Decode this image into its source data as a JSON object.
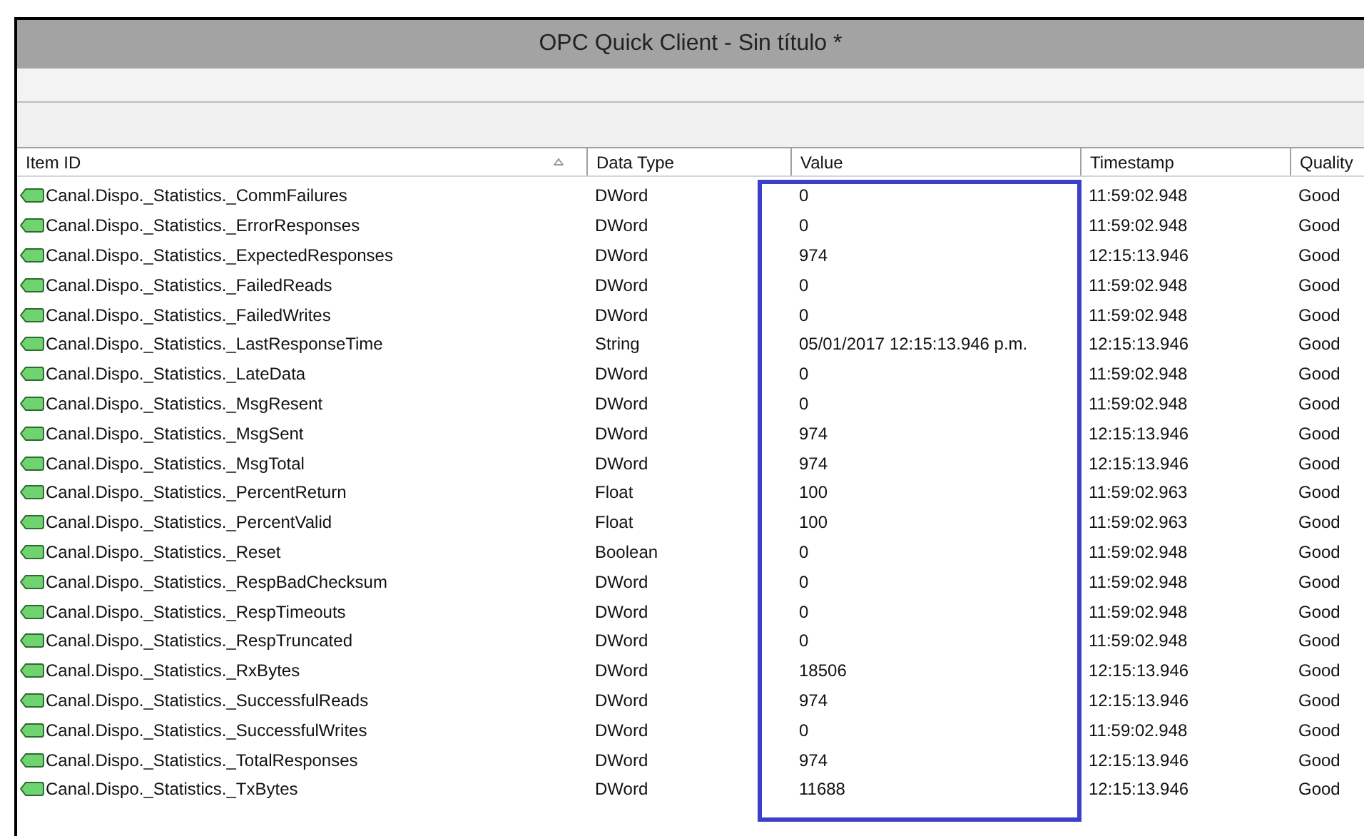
{
  "window": {
    "title": "OPC Quick Client - Sin título *"
  },
  "table": {
    "columns": [
      {
        "label": "Item ID",
        "sorted": true,
        "highlighted": false
      },
      {
        "label": "Data Type",
        "sorted": false,
        "highlighted": false
      },
      {
        "label": "Value",
        "sorted": false,
        "highlighted": true
      },
      {
        "label": "Timestamp",
        "sorted": false,
        "highlighted": false
      },
      {
        "label": "Quality",
        "sorted": false,
        "highlighted": false
      }
    ],
    "rows": [
      [
        "Canal.Dispo._Statistics._CommFailures",
        "DWord",
        "0",
        "11:59:02.948",
        "Good"
      ],
      [
        "Canal.Dispo._Statistics._ErrorResponses",
        "DWord",
        "0",
        "11:59:02.948",
        "Good"
      ],
      [
        "Canal.Dispo._Statistics._ExpectedResponses",
        "DWord",
        "974",
        "12:15:13.946",
        "Good"
      ],
      [
        "Canal.Dispo._Statistics._FailedReads",
        "DWord",
        "0",
        "11:59:02.948",
        "Good"
      ],
      [
        "Canal.Dispo._Statistics._FailedWrites",
        "DWord",
        "0",
        "11:59:02.948",
        "Good"
      ],
      [
        "Canal.Dispo._Statistics._LastResponseTime",
        "String",
        "05/01/2017 12:15:13.946 p.m.",
        "12:15:13.946",
        "Good"
      ],
      [
        "Canal.Dispo._Statistics._LateData",
        "DWord",
        "0",
        "11:59:02.948",
        "Good"
      ],
      [
        "Canal.Dispo._Statistics._MsgResent",
        "DWord",
        "0",
        "11:59:02.948",
        "Good"
      ],
      [
        "Canal.Dispo._Statistics._MsgSent",
        "DWord",
        "974",
        "12:15:13.946",
        "Good"
      ],
      [
        "Canal.Dispo._Statistics._MsgTotal",
        "DWord",
        "974",
        "12:15:13.946",
        "Good"
      ],
      [
        "Canal.Dispo._Statistics._PercentReturn",
        "Float",
        "100",
        "11:59:02.963",
        "Good"
      ],
      [
        "Canal.Dispo._Statistics._PercentValid",
        "Float",
        "100",
        "11:59:02.963",
        "Good"
      ],
      [
        "Canal.Dispo._Statistics._Reset",
        "Boolean",
        "0",
        "11:59:02.948",
        "Good"
      ],
      [
        "Canal.Dispo._Statistics._RespBadChecksum",
        "DWord",
        "0",
        "11:59:02.948",
        "Good"
      ],
      [
        "Canal.Dispo._Statistics._RespTimeouts",
        "DWord",
        "0",
        "11:59:02.948",
        "Good"
      ],
      [
        "Canal.Dispo._Statistics._RespTruncated",
        "DWord",
        "0",
        "11:59:02.948",
        "Good"
      ],
      [
        "Canal.Dispo._Statistics._RxBytes",
        "DWord",
        "18506",
        "12:15:13.946",
        "Good"
      ],
      [
        "Canal.Dispo._Statistics._SuccessfulReads",
        "DWord",
        "974",
        "12:15:13.946",
        "Good"
      ],
      [
        "Canal.Dispo._Statistics._SuccessfulWrites",
        "DWord",
        "0",
        "11:59:02.948",
        "Good"
      ],
      [
        "Canal.Dispo._Statistics._TotalResponses",
        "DWord",
        "974",
        "12:15:13.946",
        "Good"
      ],
      [
        "Canal.Dispo._Statistics._TxBytes",
        "DWord",
        "11688",
        "12:15:13.946",
        "Good"
      ]
    ]
  }
}
